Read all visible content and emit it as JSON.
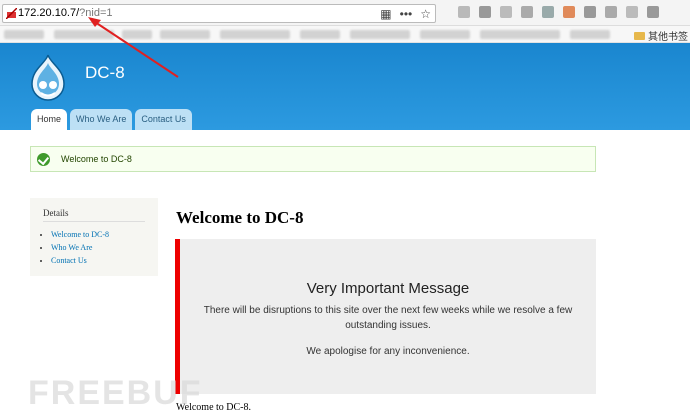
{
  "browser": {
    "url_host": "172.20.10.7/",
    "url_query": "?nid=1",
    "actions": {
      "qr": "▦",
      "more": "•••",
      "star": "☆"
    },
    "bookmarks_other": "其他书签"
  },
  "site": {
    "name": "DC-8",
    "tabs": [
      {
        "label": "Home",
        "active": true
      },
      {
        "label": "Who We Are",
        "active": false
      },
      {
        "label": "Contact Us",
        "active": false
      }
    ]
  },
  "status_message": "Welcome to DC-8",
  "sidebar": {
    "title": "Details",
    "links": [
      "Welcome to DC-8",
      "Who We Are",
      "Contact Us"
    ]
  },
  "content": {
    "title": "Welcome to DC-8",
    "notice_heading": "Very Important Message",
    "notice_p1": "There will be disruptions to this site over the next few weeks while we resolve a few outstanding issues.",
    "notice_p2": "We apologise for any inconvenience.",
    "body": "Welcome to DC-8."
  },
  "watermark": "FREEBUF",
  "colors": {
    "brand_blue": "#1a86cf",
    "alert_red": "#e00000",
    "arrow": "#e02020"
  }
}
